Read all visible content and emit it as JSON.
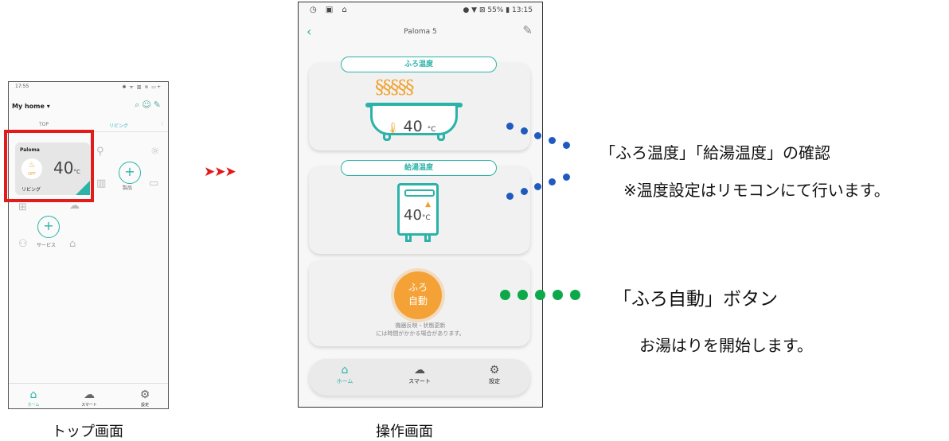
{
  "top_screen": {
    "status_time": "17:55",
    "status_icons": "✱ ᯤ ▥ ≋ ▭+",
    "home_selector": "My home ▾",
    "tabs": [
      "TOP",
      "リビング"
    ],
    "device_tile": {
      "name": "Paloma",
      "status": "OFF",
      "temperature": "40",
      "unit": "°C",
      "room": "リビング"
    },
    "add_product_label": "製品",
    "add_service_label": "サービス",
    "nav": [
      "ホーム",
      "スマート",
      "設定"
    ],
    "caption": "トップ画面"
  },
  "operation_screen": {
    "status_right": "55% ▮ 13:15",
    "status_left": "◷ ▣ ⌂",
    "device_title": "Paloma 5",
    "bath_temp_title": "ふろ温度",
    "bath_temp_value": "40",
    "hot_water_title": "給湯温度",
    "hot_water_value": "40",
    "temp_unit": "°C",
    "auto_button_line1": "ふろ",
    "auto_button_line2": "自動",
    "note_line1": "機器反映・状態更新",
    "note_line2": "には時間がかかる場合があります。",
    "nav": [
      "ホーム",
      "スマート",
      "設定"
    ],
    "caption": "操作画面"
  },
  "annotations": {
    "confirm_temps": "「ふろ温度」「給湯温度」の確認",
    "temp_setting_note": "※温度設定はリモコンにて行います。",
    "auto_button": "「ふろ自動」ボタン",
    "auto_button_desc": "お湯はりを開始します。"
  },
  "colors": {
    "accent": "#2bb3a8",
    "orange": "#f4a135",
    "highlight_red": "#e21b1b",
    "blue_dots": "#1f5bbf",
    "green_dots": "#0ca84a"
  },
  "transition_arrows": "➤➤➤"
}
